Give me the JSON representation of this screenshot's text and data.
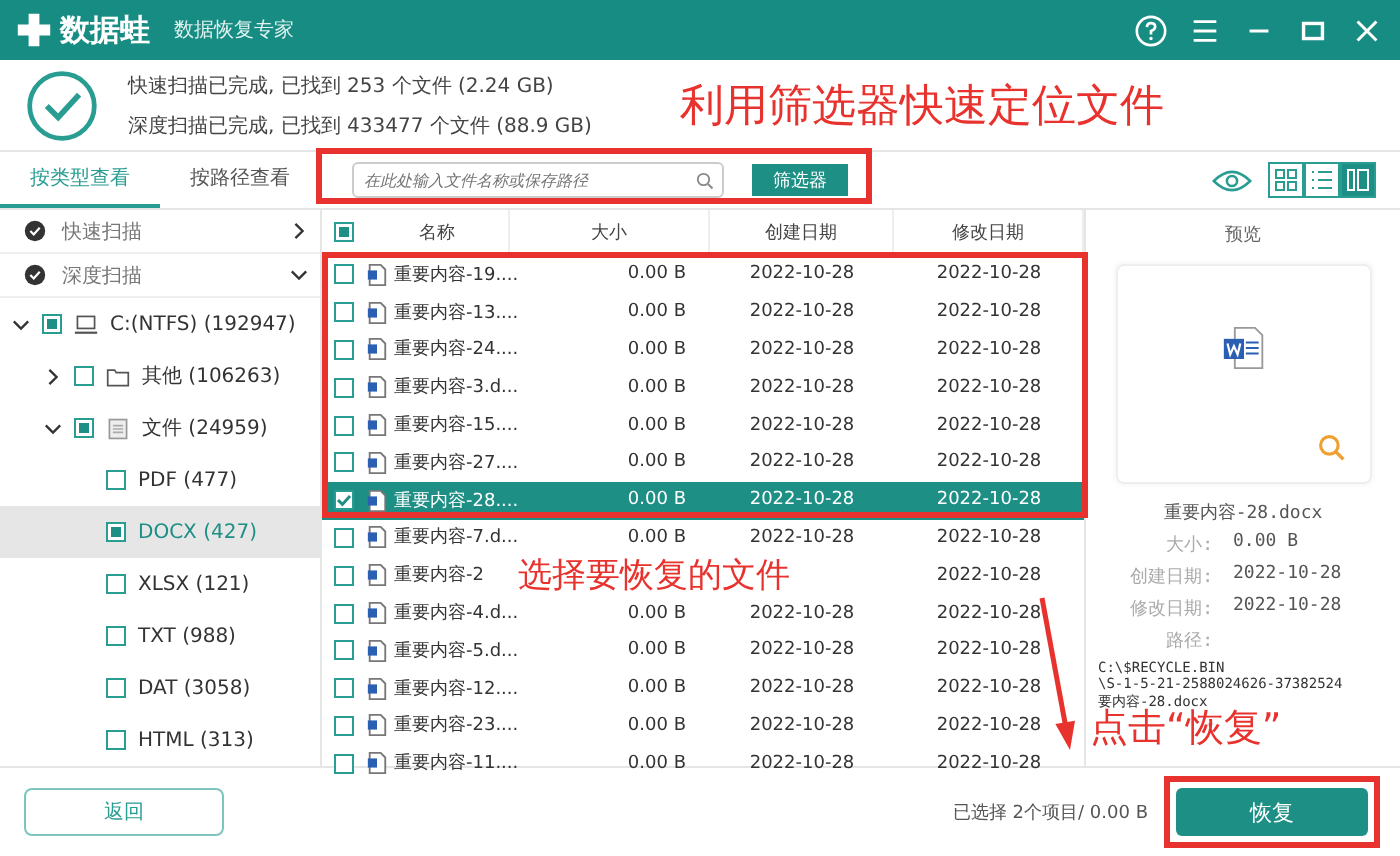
{
  "titlebar": {
    "app_name": "数据蛙",
    "subtitle": "数据恢复专家"
  },
  "scan_summary": [
    "快速扫描已完成, 已找到 253 个文件 (2.24 GB)",
    "深度扫描已完成, 已找到 433477 个文件 (88.9 GB)"
  ],
  "view_tabs": [
    {
      "label": "按类型查看",
      "selected": true
    },
    {
      "label": "按路径查看",
      "selected": false
    }
  ],
  "search": {
    "placeholder": "在此处输入文件名称或保存路径"
  },
  "filter_button": "筛选器",
  "view_modes": [
    {
      "kind": "grid",
      "selected": false
    },
    {
      "kind": "list",
      "selected": false
    },
    {
      "kind": "detail",
      "selected": true
    }
  ],
  "scans": [
    {
      "label": "快速扫描",
      "expanded": false
    },
    {
      "label": "深度扫描",
      "expanded": true
    }
  ],
  "tree": [
    {
      "label": "C:(NTFS) (192947)",
      "kind": "drive",
      "checked": true,
      "expanded": true,
      "selected": false,
      "children": [
        {
          "label": "其他 (106263)",
          "kind": "folder",
          "checked": false,
          "expanded": false,
          "selected": false
        },
        {
          "label": "文件 (24959)",
          "kind": "documents",
          "checked": true,
          "expanded": true,
          "selected": false,
          "children": [
            {
              "label": "PDF (477)",
              "checked": false,
              "selected": false
            },
            {
              "label": "DOCX (427)",
              "checked": true,
              "selected": true
            },
            {
              "label": "XLSX (121)",
              "checked": false,
              "selected": false
            },
            {
              "label": "TXT (988)",
              "checked": false,
              "selected": false
            },
            {
              "label": "DAT (3058)",
              "checked": false,
              "selected": false
            },
            {
              "label": "HTML (313)",
              "checked": false,
              "selected": false
            }
          ]
        }
      ]
    }
  ],
  "table": {
    "header_checked": true,
    "columns": [
      "名称",
      "大小",
      "创建日期",
      "修改日期"
    ],
    "rows": [
      {
        "name": "重要内容-19....",
        "size": "0.00 B",
        "created": "2022-10-28",
        "modified": "2022-10-28",
        "checked": false,
        "selected": false
      },
      {
        "name": "重要内容-13....",
        "size": "0.00 B",
        "created": "2022-10-28",
        "modified": "2022-10-28",
        "checked": false,
        "selected": false
      },
      {
        "name": "重要内容-24....",
        "size": "0.00 B",
        "created": "2022-10-28",
        "modified": "2022-10-28",
        "checked": false,
        "selected": false
      },
      {
        "name": "重要内容-3.d...",
        "size": "0.00 B",
        "created": "2022-10-28",
        "modified": "2022-10-28",
        "checked": false,
        "selected": false
      },
      {
        "name": "重要内容-15....",
        "size": "0.00 B",
        "created": "2022-10-28",
        "modified": "2022-10-28",
        "checked": false,
        "selected": false
      },
      {
        "name": "重要内容-27....",
        "size": "0.00 B",
        "created": "2022-10-28",
        "modified": "2022-10-28",
        "checked": false,
        "selected": false
      },
      {
        "name": "重要内容-28....",
        "size": "0.00 B",
        "created": "2022-10-28",
        "modified": "2022-10-28",
        "checked": true,
        "selected": true
      },
      {
        "name": "重要内容-7.d...",
        "size": "0.00 B",
        "created": "2022-10-28",
        "modified": "2022-10-28",
        "checked": false,
        "selected": false
      },
      {
        "name": "重要内容-2",
        "modified": "2022-10-28",
        "checked": false,
        "selected": false
      },
      {
        "name": "重要内容-4.d...",
        "size": "0.00 B",
        "created": "2022-10-28",
        "modified": "2022-10-28",
        "checked": false,
        "selected": false
      },
      {
        "name": "重要内容-5.d...",
        "size": "0.00 B",
        "created": "2022-10-28",
        "modified": "2022-10-28",
        "checked": false,
        "selected": false
      },
      {
        "name": "重要内容-12....",
        "size": "0.00 B",
        "created": "2022-10-28",
        "modified": "2022-10-28",
        "checked": false,
        "selected": false
      },
      {
        "name": "重要内容-23....",
        "size": "0.00 B",
        "created": "2022-10-28",
        "modified": "2022-10-28",
        "checked": false,
        "selected": false
      },
      {
        "name": "重要内容-11....",
        "size": "0.00 B",
        "created": "2022-10-28",
        "modified": "2022-10-28",
        "checked": false,
        "selected": false
      }
    ]
  },
  "preview": {
    "title": "预览",
    "filename": "重要内容-28.docx",
    "details": [
      {
        "label": "大小:",
        "value": "0.00 B"
      },
      {
        "label": "创建日期:",
        "value": "2022-10-28"
      },
      {
        "label": "修改日期:",
        "value": "2022-10-28"
      }
    ],
    "path_label": "路径:",
    "path_lines": [
      "C:\\$RECYCLE.BIN",
      "\\S-1-5-21-2588024626-37382524",
      "要内容-28.docx"
    ]
  },
  "bottom": {
    "back_button": "返回",
    "status": "已选择 2个项目/ 0.00 B",
    "recover_button": "恢复"
  },
  "annotations": [
    "利用筛选器快速定位文件",
    "选择要恢复的文件",
    "点击“恢复”"
  ]
}
